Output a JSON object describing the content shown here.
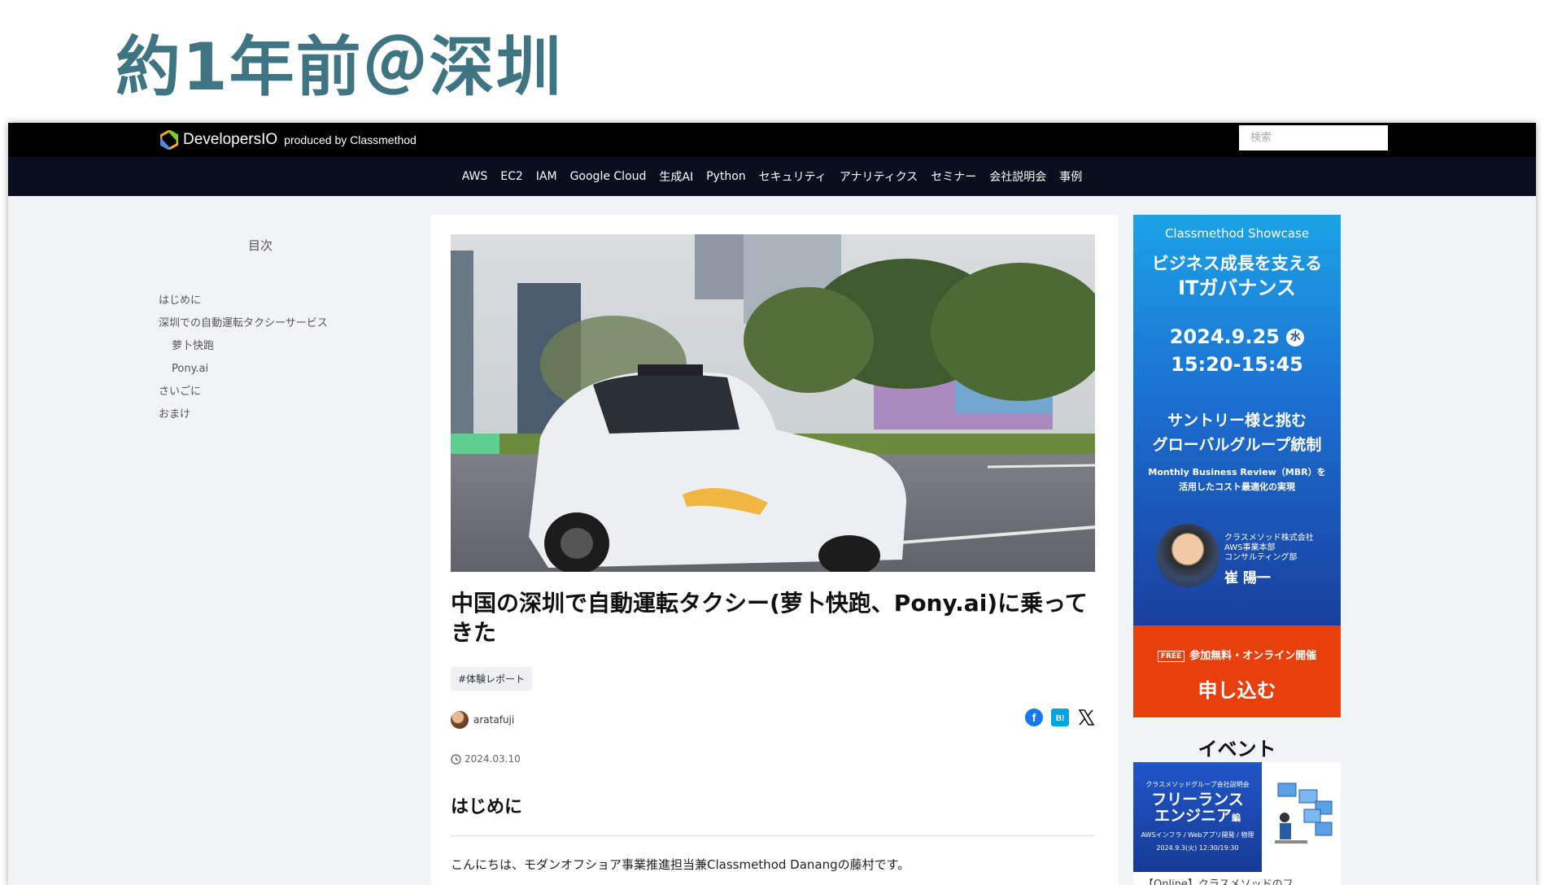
{
  "slide": {
    "title": "約1年前＠深圳"
  },
  "header": {
    "brand": "DevelopersIO",
    "produced_by": "produced by Classmethod",
    "search_placeholder": "検索"
  },
  "nav": {
    "items": [
      "AWS",
      "EC2",
      "IAM",
      "Google Cloud",
      "生成AI",
      "Python",
      "セキュリティ",
      "アナリティクス",
      "セミナー",
      "会社説明会",
      "事例"
    ]
  },
  "toc": {
    "title": "目次",
    "items": [
      {
        "label": "はじめに"
      },
      {
        "label": "深圳での自動運転タクシーサービス"
      },
      {
        "label": "萝卜快跑"
      },
      {
        "label": "Pony.ai"
      },
      {
        "label": "さいごに"
      },
      {
        "label": "おまけ"
      }
    ]
  },
  "article": {
    "title": "中国の深圳で自動運転タクシー(萝卜快跑、Pony.ai)に乗ってきた",
    "tag": "#体験レポート",
    "author": "aratafuji",
    "date": "2024.03.10",
    "heading": "はじめに",
    "intro": "こんにちは、モダンオフショア事業推進担当兼Classmethod Danangの藤村です。"
  },
  "share": {
    "facebook_label": "f",
    "hatena_label": "B!",
    "x_label": "𝕏"
  },
  "ad": {
    "showcase": "Classmethod Showcase",
    "headline1": "ビジネス成長を支える",
    "headline2": "ITガバナンス",
    "date": "2024.9.25",
    "weekday": "水",
    "time": "15:20-15:45",
    "sub1": "サントリー様と挑む",
    "sub2": "グローバルグループ統制",
    "sub3": "Monthly Business Review（MBR）を",
    "sub4": "活用したコスト最適化の実現",
    "company1": "クラスメソッド株式会社",
    "company2": "AWS事業本部",
    "company3": "コンサルティング部",
    "speaker": "崔 陽一",
    "free_badge": "FREE",
    "free_text": "参加無料・オンライン開催",
    "apply": "申し込む"
  },
  "events": {
    "title": "イベント",
    "card_small": "クラスメソッドグループ会社説明会",
    "card_big1": "フリーランス",
    "card_big2": "エンジニア",
    "card_big_suffix": "編",
    "card_sub": "AWSインフラ / Webアプリ開発 / 物理",
    "card_date": "2024.9.3(火) 12:30/19:30",
    "card_link": "【Online】クラスメソッドのフ"
  },
  "colors": {
    "title": "#3f7482",
    "nav_bg": "#0a0f1e",
    "ad_orange": "#e8400d",
    "facebook": "#1877f2",
    "hatena": "#00a4de"
  }
}
